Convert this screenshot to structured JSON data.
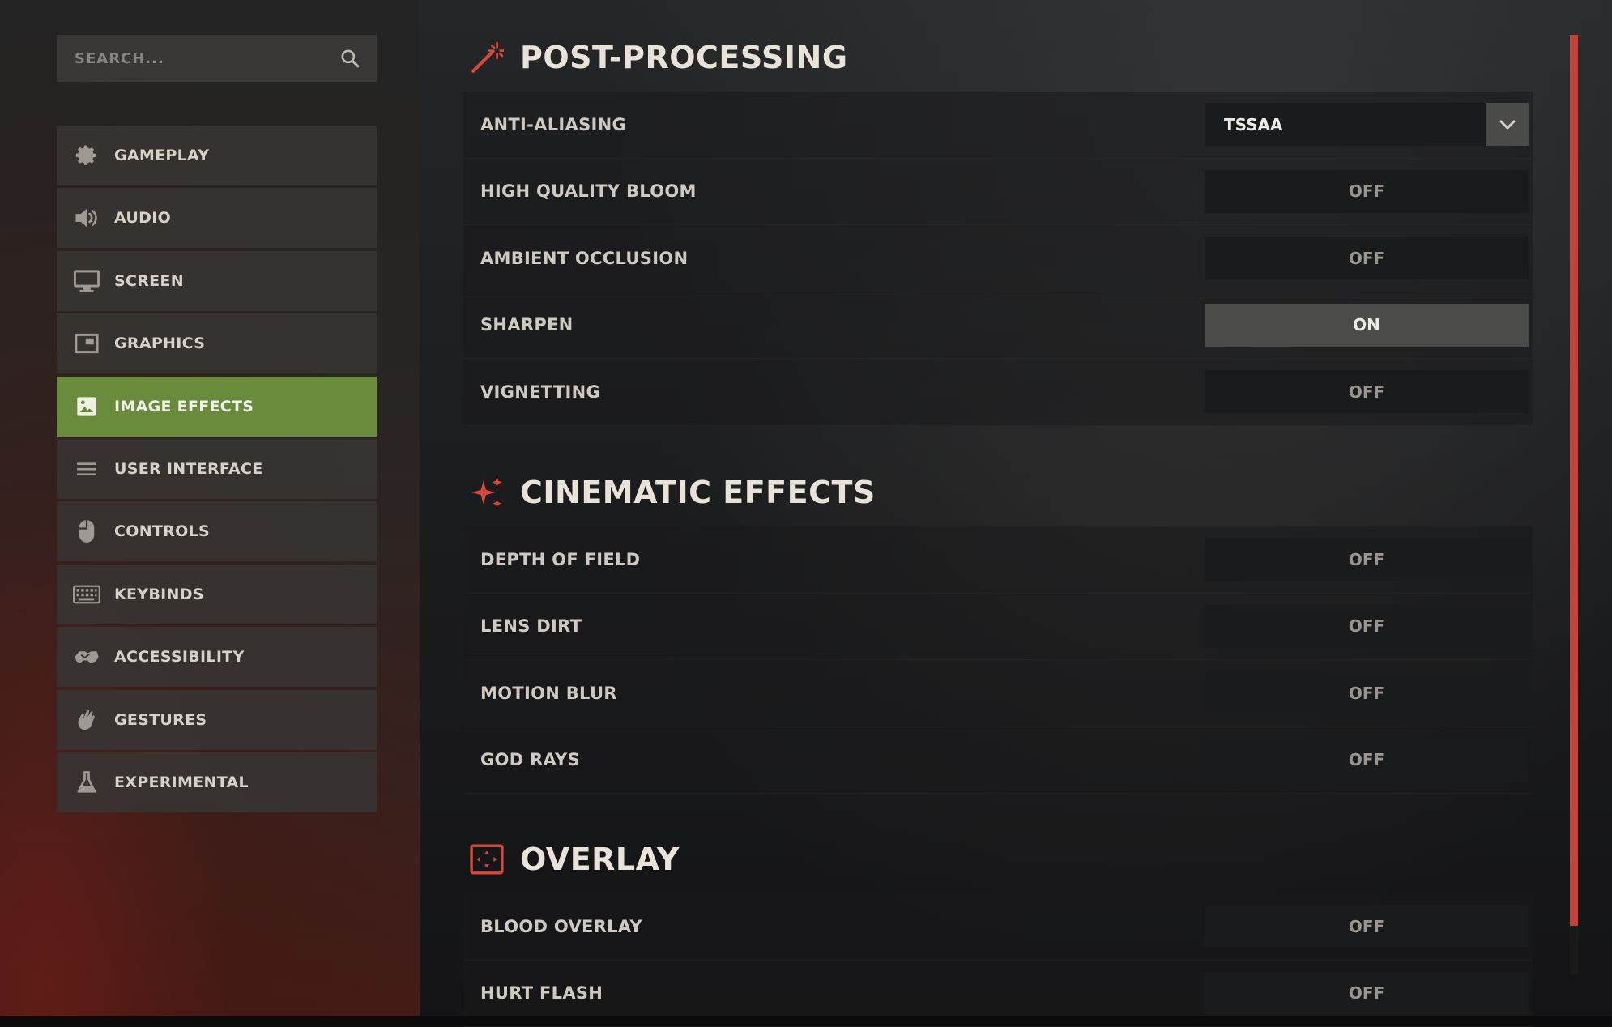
{
  "search": {
    "placeholder": "SEARCH..."
  },
  "sidebar": {
    "items": [
      {
        "label": "GAMEPLAY",
        "icon": "gear-icon"
      },
      {
        "label": "AUDIO",
        "icon": "speaker-icon"
      },
      {
        "label": "SCREEN",
        "icon": "monitor-icon"
      },
      {
        "label": "GRAPHICS",
        "icon": "picture-in-picture-icon"
      },
      {
        "label": "IMAGE EFFECTS",
        "icon": "image-icon",
        "active": true
      },
      {
        "label": "USER INTERFACE",
        "icon": "lines-icon"
      },
      {
        "label": "CONTROLS",
        "icon": "mouse-icon"
      },
      {
        "label": "KEYBINDS",
        "icon": "keyboard-icon"
      },
      {
        "label": "ACCESSIBILITY",
        "icon": "handshake-icon"
      },
      {
        "label": "GESTURES",
        "icon": "wave-hand-icon"
      },
      {
        "label": "EXPERIMENTAL",
        "icon": "flask-icon"
      }
    ]
  },
  "sections": {
    "post_processing": {
      "title": "POST-PROCESSING",
      "icon": "magic-wand-icon",
      "rows": [
        {
          "label": "ANTI-ALIASING",
          "value": "TSSAA"
        },
        {
          "label": "HIGH QUALITY BLOOM",
          "value": "OFF"
        },
        {
          "label": "AMBIENT OCCLUSION",
          "value": "OFF"
        },
        {
          "label": "SHARPEN",
          "value": "ON"
        },
        {
          "label": "VIGNETTING",
          "value": "OFF"
        }
      ]
    },
    "cinematic": {
      "title": "CINEMATIC EFFECTS",
      "icon": "sparkles-icon",
      "rows": [
        {
          "label": "DEPTH OF FIELD",
          "value": "OFF"
        },
        {
          "label": "LENS DIRT",
          "value": "OFF"
        },
        {
          "label": "MOTION BLUR",
          "value": "OFF"
        },
        {
          "label": "GOD RAYS",
          "value": "OFF"
        }
      ]
    },
    "overlay": {
      "title": "OVERLAY",
      "icon": "frame-icon",
      "rows": [
        {
          "label": "BLOOD OVERLAY",
          "value": "OFF"
        },
        {
          "label": "HURT FLASH",
          "value": "OFF"
        }
      ]
    }
  },
  "colors": {
    "accent_red": "#c0443a",
    "active_green": "#6a8a3c"
  }
}
